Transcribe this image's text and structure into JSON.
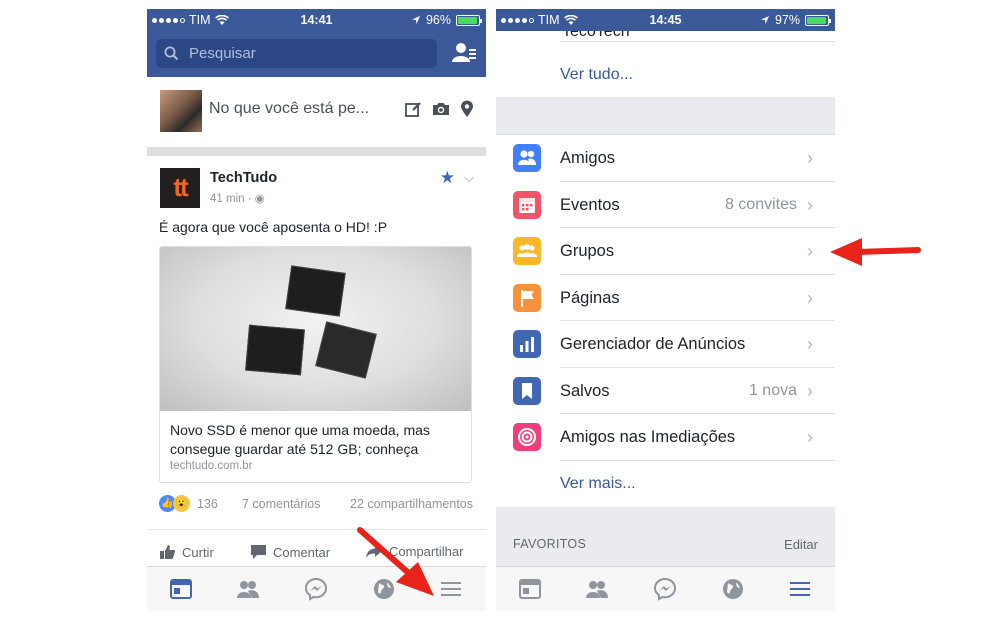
{
  "left_phone": {
    "status": {
      "carrier": "TIM",
      "time": "14:41",
      "battery": "96%",
      "battery_level": 0.96
    },
    "search": {
      "placeholder": "Pesquisar"
    },
    "composer": {
      "prompt": "No que você está pe..."
    },
    "post": {
      "author": "TechTudo",
      "logo_text": "tt",
      "time": "41 min · ",
      "text": "É agora que você aposenta o HD! :P",
      "link_title": "Novo SSD é menor que uma moeda, mas consegue guardar até 512 GB; conheça",
      "link_domain": "techtudo.com.br",
      "reaction_count": "136",
      "comments": "7 comentários",
      "shares": "22 compartilhamentos"
    },
    "actions": {
      "like": "Curtir",
      "comment": "Comentar",
      "share": "Compartilhar"
    }
  },
  "right_phone": {
    "status": {
      "carrier": "TIM",
      "time": "14:45",
      "battery": "97%",
      "battery_level": 0.97
    },
    "cut_item": "TecoTech",
    "see_all": "Ver tudo...",
    "menu": [
      {
        "label": "Amigos",
        "count": "",
        "icon": "friends-icon",
        "color": "#4080ff"
      },
      {
        "label": "Eventos",
        "count": "8 convites",
        "icon": "calendar-icon",
        "color": "#f35369"
      },
      {
        "label": "Grupos",
        "count": "",
        "icon": "groups-icon",
        "color": "#f7b928"
      },
      {
        "label": "Páginas",
        "count": "",
        "icon": "flag-icon",
        "color": "#f7923b"
      },
      {
        "label": "Gerenciador de Anúncios",
        "count": "",
        "icon": "bar-chart-icon",
        "color": "#4267b2"
      },
      {
        "label": "Salvos",
        "count": "1 nova",
        "icon": "bookmark-icon",
        "color": "#4267b2"
      },
      {
        "label": "Amigos nas Imediações",
        "count": "",
        "icon": "nearby-icon",
        "color": "#ee3f7a"
      }
    ],
    "see_more": "Ver mais...",
    "favorites": {
      "title": "FAVORITOS",
      "edit": "Editar"
    }
  },
  "colors": {
    "fb_blue": "#3b5998",
    "arrow_red": "#e8231a",
    "tab_active": "#4267b2",
    "tab_inactive": "#90949c"
  }
}
